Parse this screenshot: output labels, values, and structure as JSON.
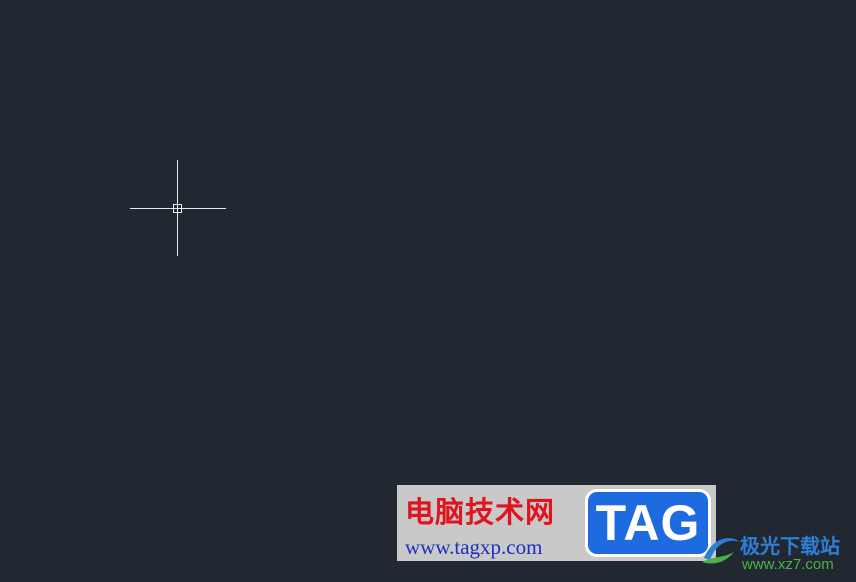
{
  "canvas": {
    "background": "#222831",
    "cursor_icon": "crosshair-cursor-icon"
  },
  "watermark": {
    "title_cn": "电脑技术网",
    "url": "www.tagxp.com",
    "badge": "TAG",
    "title_color": "#e0141e",
    "url_color": "#1d2fbf",
    "badge_color": "#1e6be0"
  },
  "logo2": {
    "name_cn": "极光下载站",
    "url": "www.xz7.com",
    "name_color": "#2d7fd6",
    "url_color": "#49b34a"
  }
}
